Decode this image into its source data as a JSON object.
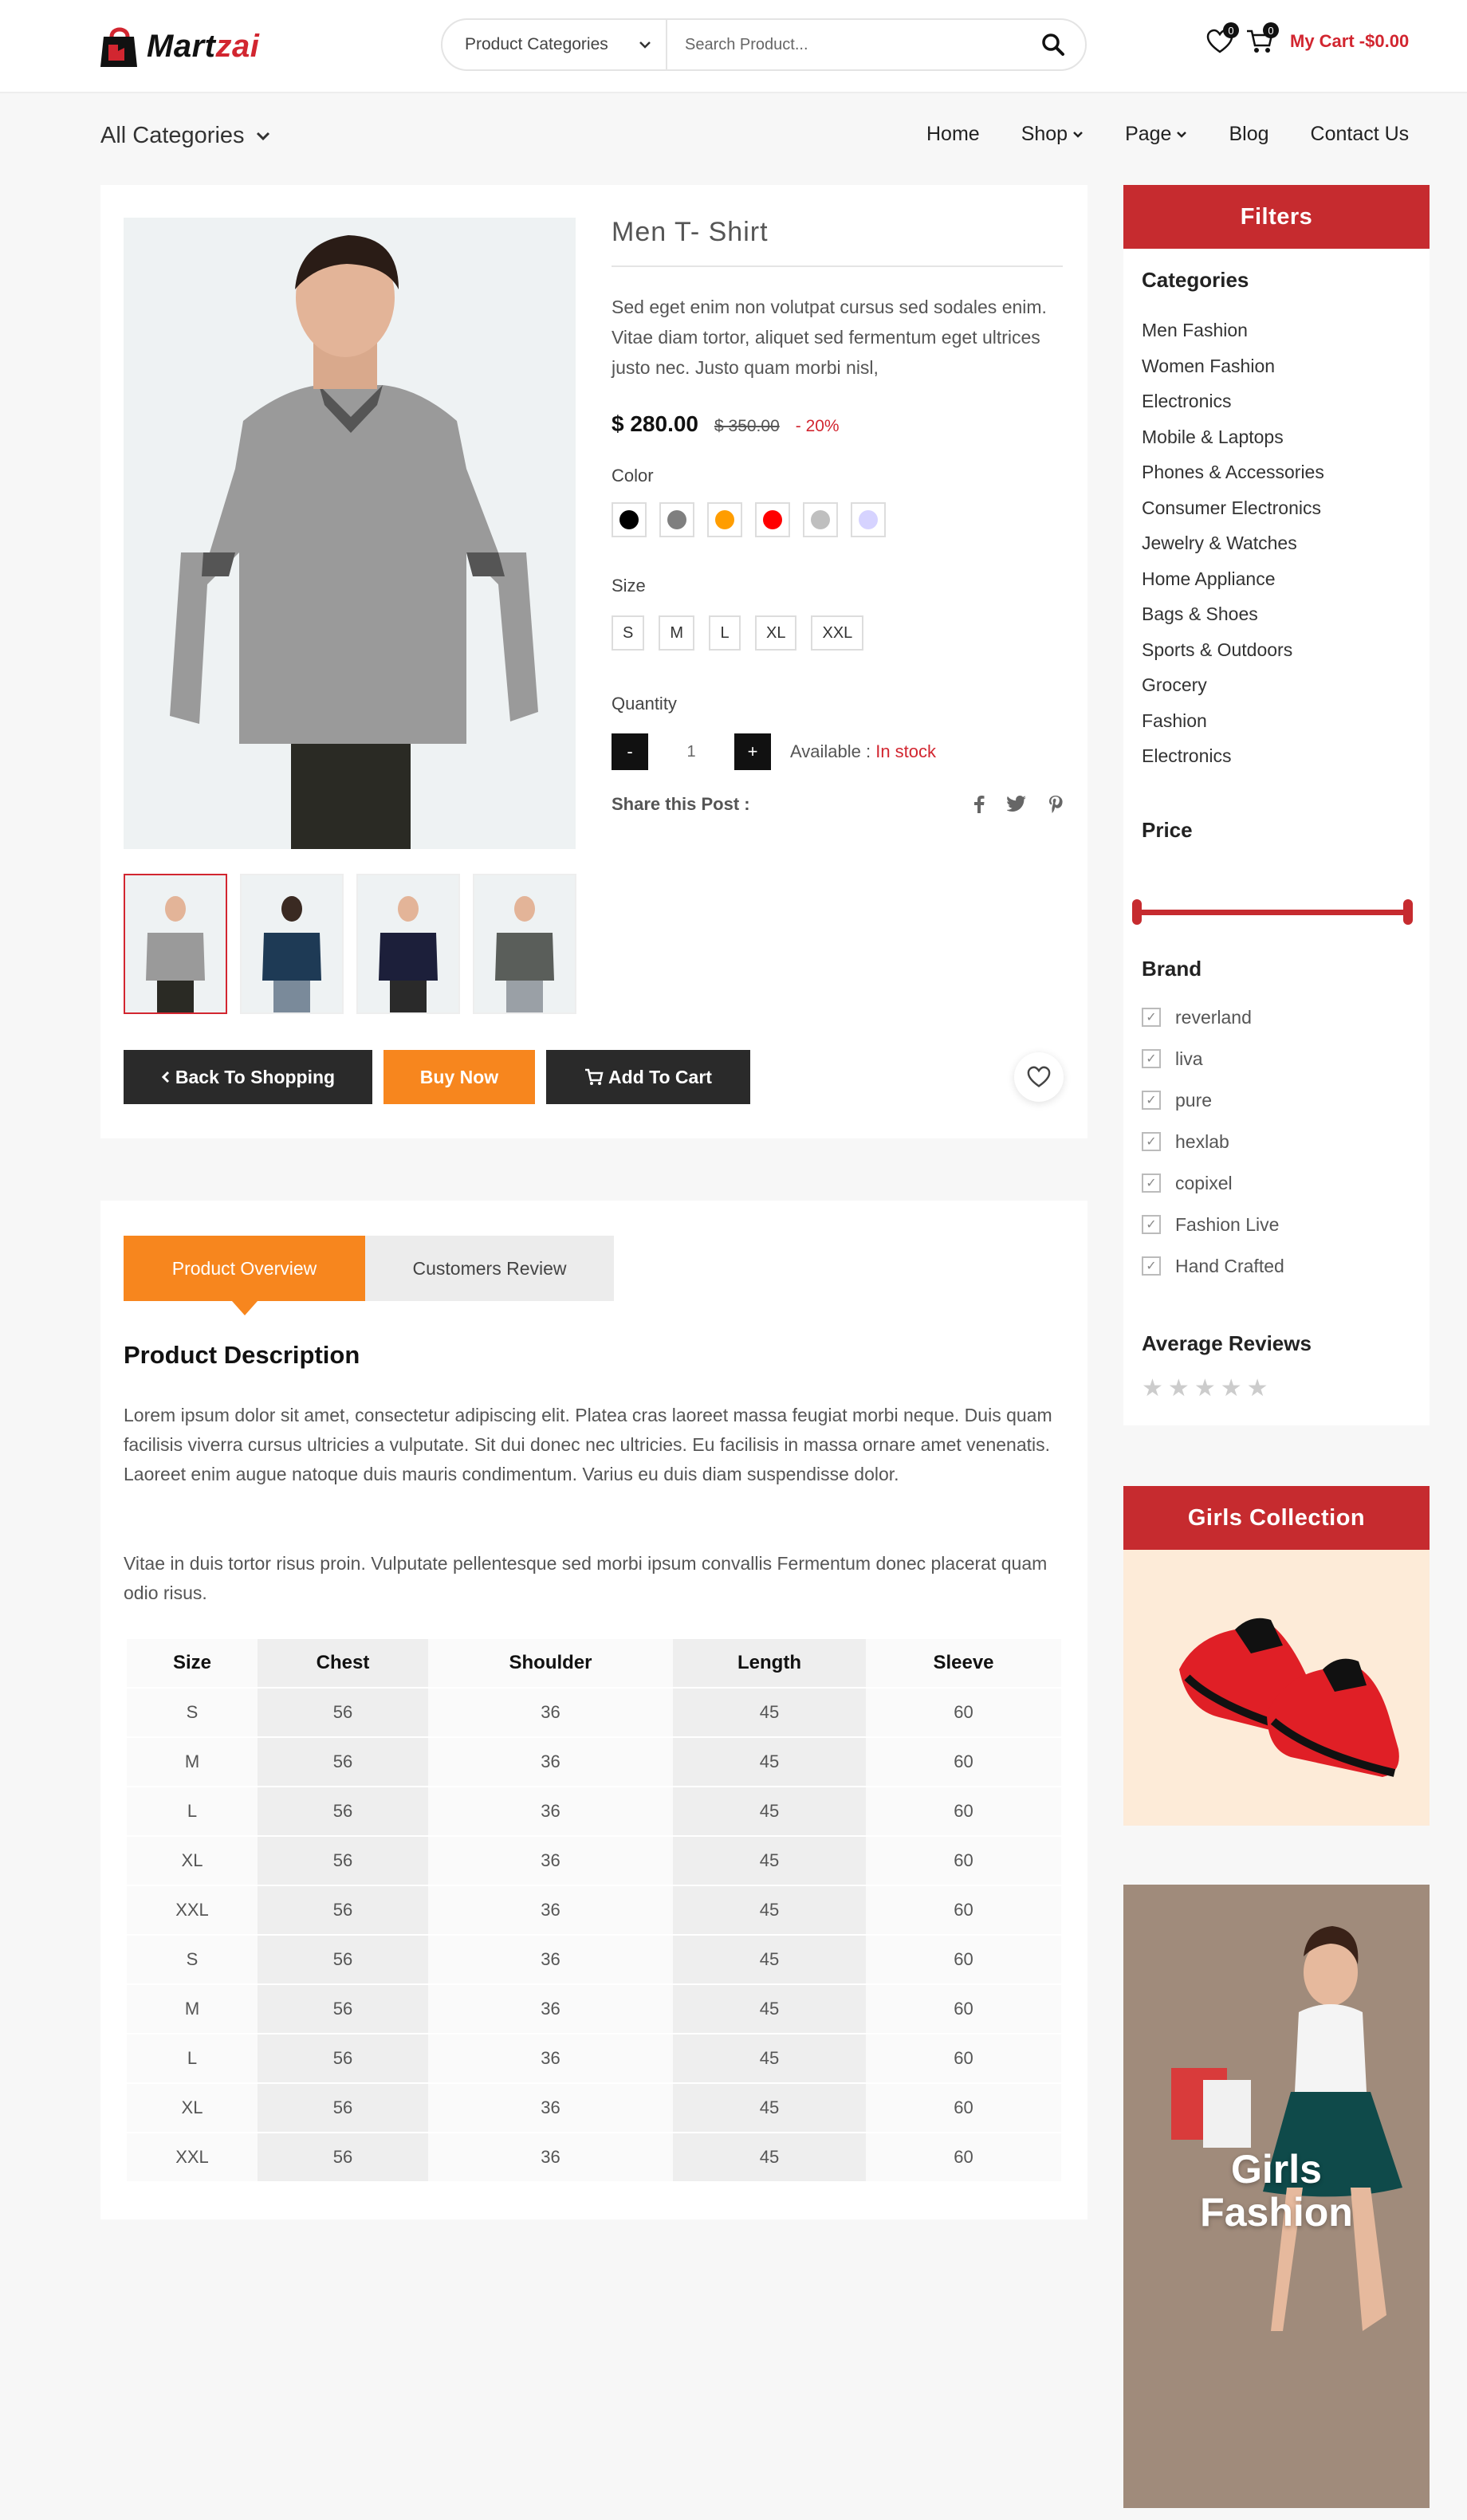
{
  "header": {
    "logo_part1": "Mart",
    "logo_part2": "zai",
    "category_select": "Product Categories",
    "search_placeholder": "Search Product...",
    "wishlist_count": "0",
    "cart_count": "0",
    "cart_label": "My Cart -$0.00"
  },
  "nav": {
    "all_categories": "All Categories",
    "items": [
      "Home",
      "Shop",
      "Page",
      "Blog",
      "Contact Us"
    ]
  },
  "product": {
    "title": "Men T- Shirt",
    "description": "Sed eget enim non volutpat cursus sed sodales enim. Vitae diam tortor, aliquet sed fermentum eget ultrices justo nec. Justo quam morbi nisl,",
    "price": "$ 280.00",
    "old_price": "$ 350.00",
    "discount": "- 20%",
    "color_label": "Color",
    "colors": [
      "#000000",
      "#7f7f7f",
      "#ff9d00",
      "#ff0000",
      "#bfbfbf",
      "#d6d3ff"
    ],
    "size_label": "Size",
    "sizes": [
      "S",
      "M",
      "L",
      "XL",
      "XXL"
    ],
    "quantity_label": "Quantity",
    "qty_minus": "-",
    "qty_value": "1",
    "qty_plus": "+",
    "available_label": "Available : ",
    "stock_status": "In stock",
    "share_label": "Share this Post :",
    "back_button": "Back To Shopping",
    "buy_button": "Buy Now",
    "cart_button": "Add To Cart"
  },
  "tabs": {
    "overview": "Product Overview",
    "reviews": "Customers Review"
  },
  "description": {
    "title": "Product Description",
    "p1": "Lorem ipsum dolor sit amet, consectetur adipiscing elit. Platea cras laoreet massa feugiat morbi neque. Duis quam facilisis viverra cursus ultricies a vulputate. Sit dui donec nec ultricies. Eu facilisis in massa ornare amet venenatis. Laoreet enim augue natoque duis mauris condimentum. Varius eu duis diam suspendisse dolor.",
    "p2": "Vitae in duis tortor risus proin. Vulputate pellentesque sed morbi ipsum convallis Fermentum donec placerat quam odio risus."
  },
  "size_table": {
    "headers": [
      "Size",
      "Chest",
      "Shoulder",
      "Length",
      "Sleeve"
    ],
    "rows": [
      [
        "S",
        "56",
        "36",
        "45",
        "60"
      ],
      [
        "M",
        "56",
        "36",
        "45",
        "60"
      ],
      [
        "L",
        "56",
        "36",
        "45",
        "60"
      ],
      [
        "XL",
        "56",
        "36",
        "45",
        "60"
      ],
      [
        "XXL",
        "56",
        "36",
        "45",
        "60"
      ],
      [
        "S",
        "56",
        "36",
        "45",
        "60"
      ],
      [
        "M",
        "56",
        "36",
        "45",
        "60"
      ],
      [
        "L",
        "56",
        "36",
        "45",
        "60"
      ],
      [
        "XL",
        "56",
        "36",
        "45",
        "60"
      ],
      [
        "XXL",
        "56",
        "36",
        "45",
        "60"
      ]
    ]
  },
  "sidebar": {
    "filters_title": "Filters",
    "categories_title": "Categories",
    "categories": [
      "Men Fashion",
      "Women Fashion",
      "Electronics",
      "Mobile & Laptops",
      "Phones & Accessories",
      "Consumer Electronics",
      "Jewelry & Watches",
      "Home Appliance",
      "Bags & Shoes",
      "Sports & Outdoors",
      "Grocery",
      "Fashion",
      "Electronics"
    ],
    "price_title": "Price",
    "brand_title": "Brand",
    "brands": [
      "reverland",
      "liva",
      "pure",
      "hexlab",
      "copixel",
      "Fashion Live",
      "Hand Crafted"
    ],
    "reviews_title": "Average Reviews",
    "girls_collection": "Girls Collection",
    "girls_fashion_1": "Girls",
    "girls_fashion_2": "Fashion"
  },
  "colors": {
    "brand_red": "#c62b2f",
    "accent_orange": "#f7861e",
    "dark_button": "#2a2a2a"
  }
}
